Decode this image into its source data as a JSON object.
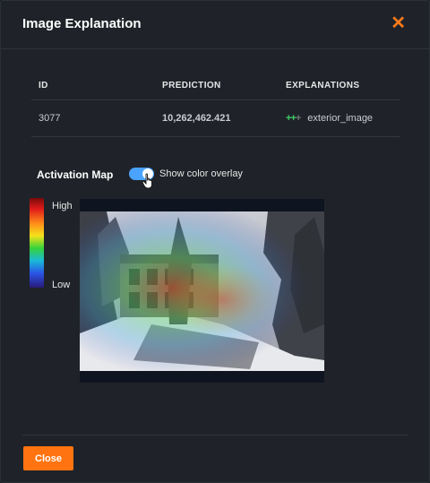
{
  "modal": {
    "title": "Image Explanation",
    "close_icon": "close-x-icon"
  },
  "table": {
    "headers": [
      "ID",
      "PREDICTION",
      "EXPLANATIONS"
    ],
    "row": {
      "id": "3077",
      "prediction": "10,262,462.421",
      "explanation_icon": "positive-strength-icon",
      "explanation_icon_text": "+++",
      "explanation": "exterior_image"
    }
  },
  "activation": {
    "label": "Activation Map",
    "toggle_on": true,
    "toggle_label": "Show color overlay"
  },
  "legend": {
    "high": "High",
    "low": "Low"
  },
  "footer": {
    "close_label": "Close"
  },
  "colors": {
    "accent": "#ff7410",
    "prediction": "#ef4b45",
    "toggle": "#4aa3ff",
    "positive": "#3fd16a"
  }
}
